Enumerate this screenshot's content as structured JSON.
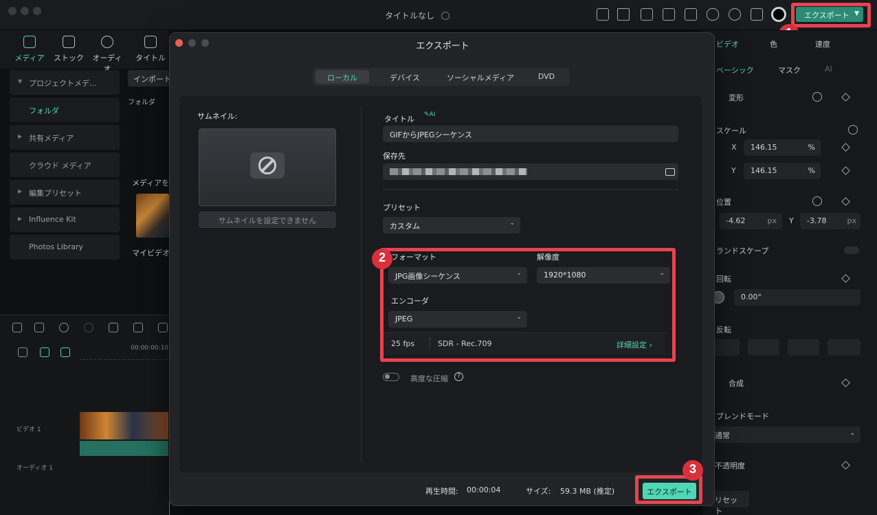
{
  "window": {
    "title": "タイトルなし"
  },
  "topbar": {
    "export_label": "エクスポート"
  },
  "left_tools": [
    "メディア",
    "ストック",
    "オーディオ",
    "タイトル"
  ],
  "media_sidebar": [
    "プロジェクトメデ...",
    "フォルダ",
    "共有メディア",
    "クラウド メディア",
    "編集プリセット",
    "Influence Kit",
    "Photos Library"
  ],
  "media_panel": {
    "import_label": "インポート",
    "folder_label": "フォルダ",
    "media_hint": "メディアを",
    "clip_name": "マイビデオ"
  },
  "timeline": {
    "timecode": "00:00:00:10",
    "video_track": "ビデオ 1",
    "audio_track": "オーディオ 1"
  },
  "right_panel": {
    "tabs": [
      "ビデオ",
      "色",
      "速度"
    ],
    "subtabs": [
      "ベーシック",
      "マスク",
      "AI"
    ],
    "transform": "変形",
    "scale": "スケール",
    "scale_x": "146.15",
    "scale_y": "146.15",
    "percent": "%",
    "position": "位置",
    "pos_x": "-4.62",
    "pos_y": "-3.78",
    "px": "px",
    "x_label": "X",
    "y_label": "Y",
    "landscape": "ランドスケープ",
    "rotate": "回転",
    "rotate_value": "0.00°",
    "flip": "反転",
    "composite": "合成",
    "blend_mode": "ブレンドモード",
    "blend_value": "通常",
    "opacity": "不透明度",
    "reset": "リセット"
  },
  "dialog": {
    "title": "エクスポート",
    "tabs": [
      "ローカル",
      "デバイス",
      "ソーシャルメディア",
      "DVD"
    ],
    "thumbnail_label": "サムネイル:",
    "thumbnail_button": "サムネイルを設定できません",
    "title_label": "タイトル",
    "ai_badge": "AI",
    "title_value": "GIFからJPEGシーケンス",
    "save_to_label": "保存先",
    "preset_label": "プリセット",
    "preset_value": "カスタム",
    "format_label": "フォーマット",
    "format_value": "JPG画像シーケンス",
    "resolution_label": "解像度",
    "resolution_value": "1920*1080",
    "encoder_label": "エンコーダ",
    "encoder_value": "JPEG",
    "fps": "25 fps",
    "color": "SDR - Rec.709",
    "advanced": "詳細設定",
    "compression_label": "高度な圧縮",
    "duration_label": "再生時間:",
    "duration_value": "00:00:04",
    "size_label": "サイズ:",
    "size_value": "59.3 MB (推定)",
    "export_button": "エクスポート"
  },
  "annotations": [
    "1",
    "2",
    "3"
  ],
  "colors": {
    "accent": "#4fd6b6",
    "highlight": "#e6444f",
    "badge": "#d9303c"
  }
}
